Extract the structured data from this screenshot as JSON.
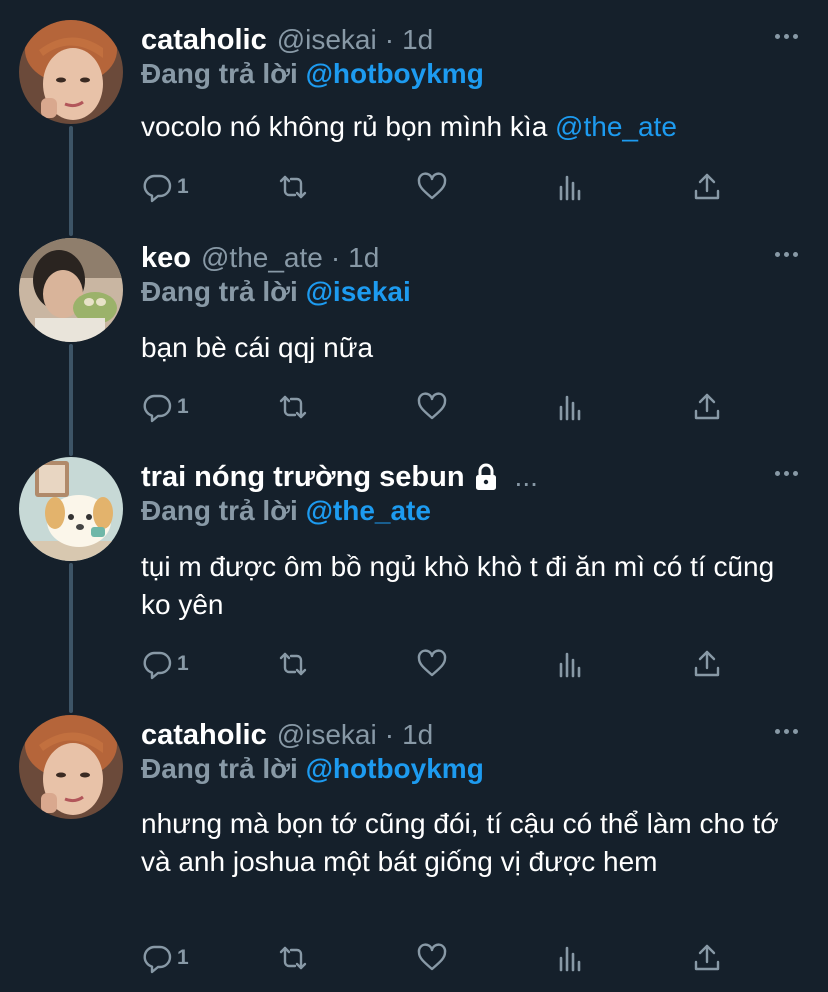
{
  "reply_label": "Đang trả lời",
  "tweets": [
    {
      "name": "cataholic",
      "handle": "@isekai",
      "separator": "·",
      "time": "1d",
      "reply_to": "@hotboykmg",
      "text": "vocolo nó không rủ bọn mình kìa ",
      "text_mention": "@the_ate",
      "reply_count": "1",
      "locked": false
    },
    {
      "name": "keo",
      "handle": "@the_ate",
      "separator": "·",
      "time": "1d",
      "reply_to": "@isekai",
      "text": "bạn bè cái qqj nữa",
      "text_mention": "",
      "reply_count": "1",
      "locked": false
    },
    {
      "name": "trai nóng trường sebun",
      "handle": "",
      "separator": "",
      "time": "",
      "reply_to": "@the_ate",
      "text": "tụi m được ôm bồ ngủ khò khò t đi ăn mì có tí cũng ko yên",
      "text_mention": "",
      "reply_count": "1",
      "locked": true,
      "name_overflow": "..."
    },
    {
      "name": "cataholic",
      "handle": "@isekai",
      "separator": "·",
      "time": "1d",
      "reply_to": "@hotboykmg",
      "text": "nhưng mà bọn tớ cũng đói, tí cậu có thể làm cho tớ và anh joshua một bát giống vị được hem",
      "text_mention": "",
      "reply_count": "1",
      "locked": false
    }
  ],
  "icons": {
    "reply": "reply-icon",
    "retweet": "retweet-icon",
    "like": "heart-icon",
    "analytics": "analytics-icon",
    "share": "share-icon",
    "more": "more-icon",
    "lock": "lock-icon"
  },
  "colors": {
    "background": "#15202b",
    "text": "#ffffff",
    "muted": "#8899a6",
    "mention": "#1d9bf0",
    "thread_line": "#3d5466"
  }
}
